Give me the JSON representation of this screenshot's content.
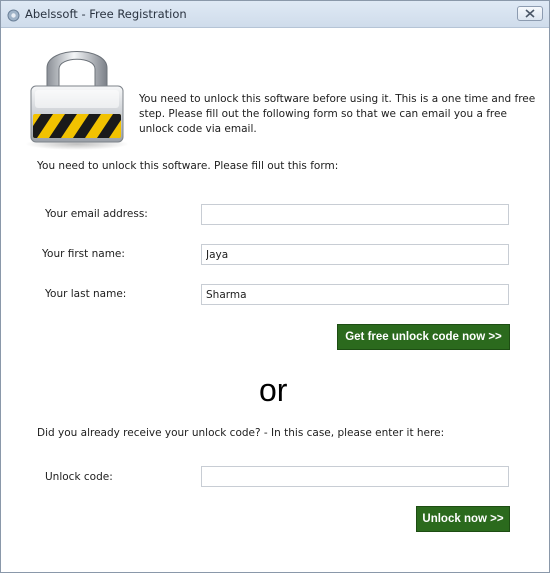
{
  "window": {
    "title": "Abelssoft - Free Registration",
    "icon": "abelssoft-app-icon"
  },
  "header": {
    "lock_icon": "padlock-icon",
    "intro_text": "You need to unlock this software before using it. This is a one time and free step. Please fill out the following form so that we can email you a free unlock code via email."
  },
  "form": {
    "instruction": "You need to unlock this software. Please fill out this form:",
    "email_label": "Your email address:",
    "email_value": "",
    "first_name_label": "Your first name:",
    "first_name_value": "Jaya",
    "last_name_label": "Your last name:",
    "last_name_value": "Sharma",
    "submit_label": "Get free unlock code now >>"
  },
  "separator": "or",
  "unlock": {
    "instruction": "Did you already receive your unlock code? - In this case, please enter it here:",
    "code_label": "Unlock code:",
    "code_value": "",
    "button_label": "Unlock now >>"
  },
  "colors": {
    "button_green": "#2b6a1d",
    "titlebar": "#dfe9f5"
  }
}
